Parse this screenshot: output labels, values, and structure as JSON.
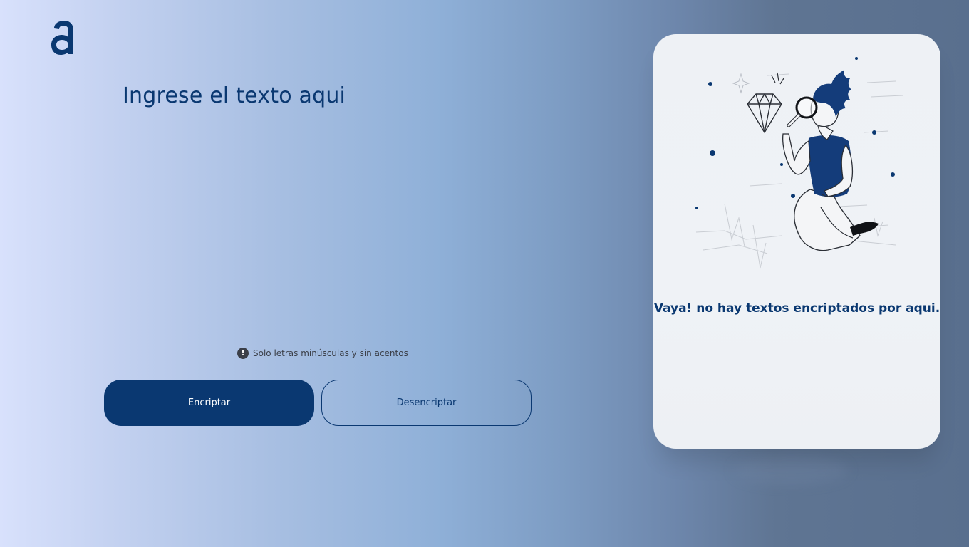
{
  "logo": {
    "icon": "alura-logo-icon",
    "color": "#0a3871"
  },
  "main": {
    "title": "Ingrese el texto aqui",
    "input_value": "",
    "hint": {
      "icon": "exclamation-circle-icon",
      "text": "Solo letras minúsculas y sin acentos"
    },
    "buttons": {
      "encrypt_label": "Encriptar",
      "decrypt_label": "Desencriptar"
    }
  },
  "output_card": {
    "illustration": "person-with-magnifying-glass-illustration",
    "message": "Vaya! no hay textos encriptados por aqui."
  },
  "colors": {
    "accent": "#0a3871",
    "card_background": "#eff2f6"
  }
}
